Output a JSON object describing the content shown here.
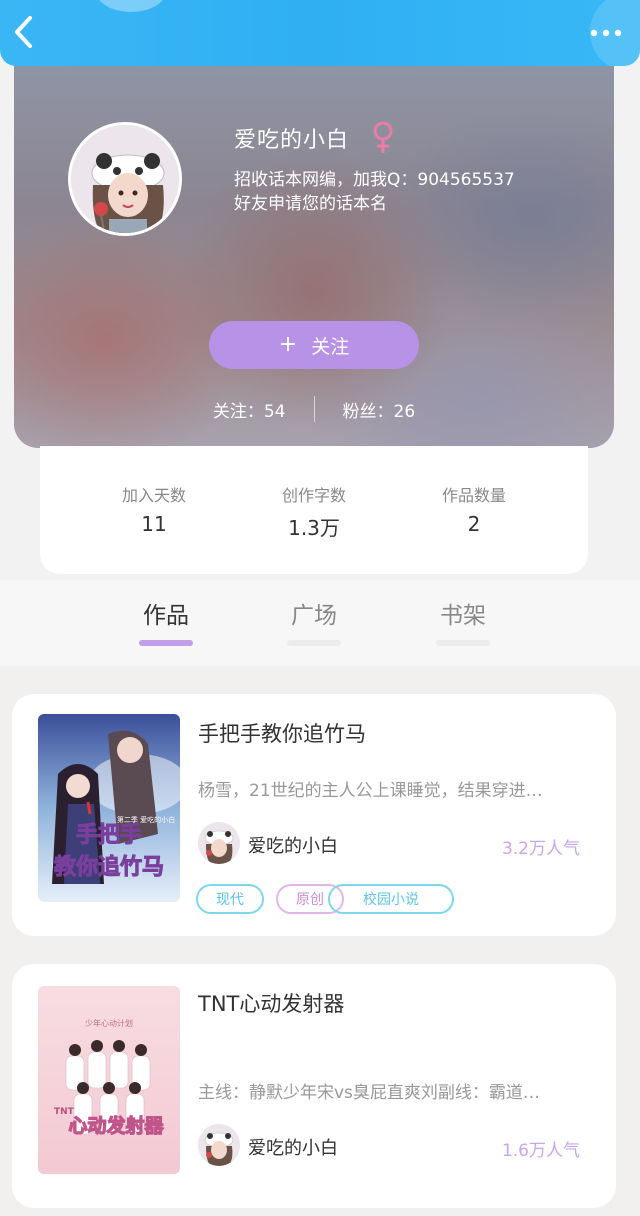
{
  "header": {
    "back_icon": "chevron-left-icon",
    "more_icon": "more-dots-icon"
  },
  "profile": {
    "username": "爱吃的小白",
    "gender_icon": "female-icon",
    "gender_color": "#e87ea6",
    "bio": "招收话本网编，加我Q：904565537\n好友申请您的话本名",
    "follow_button": "关注",
    "following_label": "关注：54",
    "followers_label": "粉丝：26"
  },
  "stats": [
    {
      "label": "加入天数",
      "value": "11"
    },
    {
      "label": "创作字数",
      "value": "1.3万"
    },
    {
      "label": "作品数量",
      "value": "2"
    }
  ],
  "tabs": [
    {
      "label": "作品",
      "active": true
    },
    {
      "label": "广场",
      "active": false
    },
    {
      "label": "书架",
      "active": false
    }
  ],
  "works": [
    {
      "title": "手把手教你追竹马",
      "description": "杨雪，21世纪的主人公上课睡觉，结果穿进…",
      "author": "爱吃的小白",
      "popularity": "3.2万人气",
      "cover_text": "手把手教你追竹马",
      "cover_subtitle": "第二季 爱吃的小白",
      "tags": [
        "现代",
        "原创",
        "校园小说"
      ]
    },
    {
      "title": "TNT心动发射器",
      "description": "主线：静默少年宋vs臭屁直爽刘副线：霸道…",
      "author": "爱吃的小白",
      "popularity": "1.6万人气",
      "cover_text": "心动发射器",
      "cover_subtitle": "TNT",
      "cover_tagline": "少年心动计划"
    }
  ],
  "colors": {
    "accent_blue": "#2fb0f3",
    "accent_purple": "#b892e6",
    "popularity": "#c9a6ec"
  }
}
